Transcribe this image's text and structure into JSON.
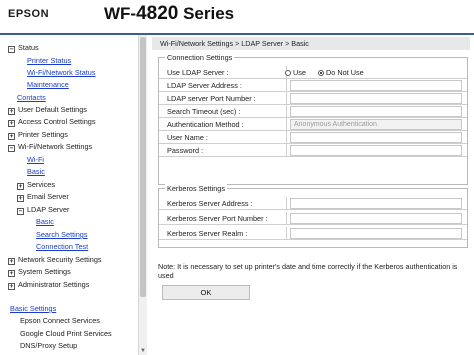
{
  "header": {
    "brand": "EPSON",
    "model_prefix": "WF-",
    "model_number": "4820",
    "model_suffix": " Series"
  },
  "sidebar": {
    "status": "Status",
    "printer_status": "Printer Status",
    "wifi_network_status": "Wi-Fi/Network Status",
    "maintenance": "Maintenance",
    "contacts": "Contacts",
    "user_default_settings": "User Default Settings",
    "access_control_settings": "Access Control Settings",
    "printer_settings": "Printer Settings",
    "wifi_network_settings": "Wi-Fi/Network Settings",
    "wifi": "Wi-Fi",
    "basic": "Basic",
    "services": "Services",
    "email_server": "Email Server",
    "ldap_server": "LDAP Server",
    "ldap_basic": "Basic",
    "search_settings": "Search Settings",
    "connection_test": "Connection Test",
    "network_security_settings": "Network Security Settings",
    "system_settings": "System Settings",
    "administrator_settings": "Administrator Settings",
    "basic_settings": "Basic Settings",
    "epson_connect_services": "Epson Connect Services",
    "google_cloud_print_services": "Google Cloud Print Services",
    "dns_proxy_setup": "DNS/Proxy Setup",
    "expand_symbol": "+",
    "collapse_symbol": "−"
  },
  "main": {
    "breadcrumb": "Wi-Fi/Network Settings > LDAP Server > Basic",
    "connection_settings": {
      "title": "Connection Settings",
      "use_ldap_label": "Use LDAP Server :",
      "use_option": "Use",
      "do_not_use_option": "Do Not Use",
      "selected": "Do Not Use",
      "ldap_server_address": "LDAP Server Address :",
      "ldap_server_port": "LDAP server Port Number :",
      "search_timeout": "Search Timeout (sec) :",
      "auth_method_label": "Authentication Method :",
      "auth_method_value": "Anonymous Authentication",
      "user_name": "User Name :",
      "password": "Password :"
    },
    "kerberos_settings": {
      "title": "Kerberos Settings",
      "server_address": "Kerberos Server Address :",
      "server_port": "Kerberos Server Port Number :",
      "server_realm": "Kerberos Server Realm :"
    },
    "note": "Note: It is necessary to set up printer's date and time correctly if the Kerberos authentication is used",
    "ok_label": "OK"
  }
}
